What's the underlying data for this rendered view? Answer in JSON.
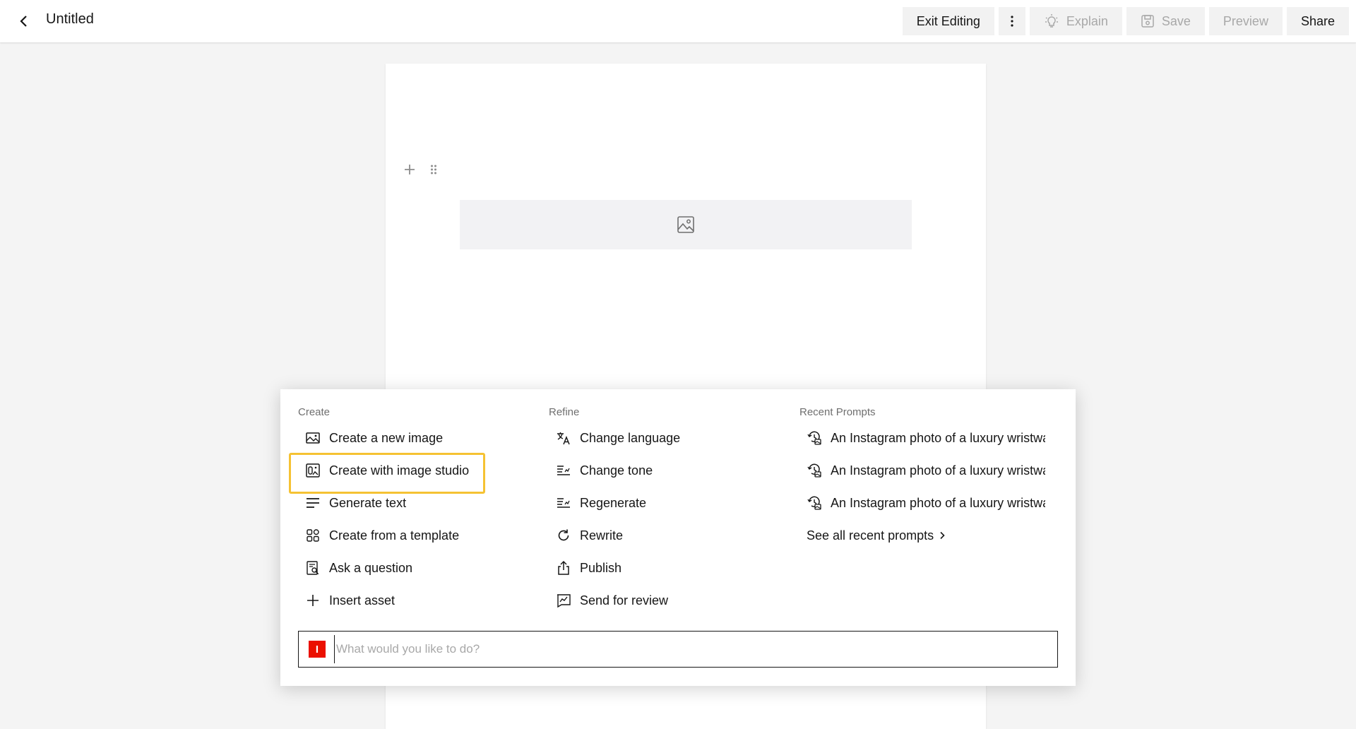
{
  "header": {
    "title": "Untitled",
    "actions": {
      "exit_editing": "Exit Editing",
      "explain": "Explain",
      "save": "Save",
      "preview": "Preview",
      "share": "Share"
    }
  },
  "popup": {
    "create": {
      "heading": "Create",
      "items": [
        {
          "label": "Create a new image",
          "icon": "image-icon"
        },
        {
          "label": "Create with image studio",
          "icon": "image-studio-icon",
          "highlighted": true
        },
        {
          "label": "Generate text",
          "icon": "text-lines-icon"
        },
        {
          "label": "Create from a template",
          "icon": "template-grid-icon"
        },
        {
          "label": "Ask a question",
          "icon": "ask-question-icon"
        },
        {
          "label": "Insert asset",
          "icon": "plus-icon"
        }
      ]
    },
    "refine": {
      "heading": "Refine",
      "items": [
        {
          "label": "Change language",
          "icon": "translate-icon"
        },
        {
          "label": "Change tone",
          "icon": "tone-icon"
        },
        {
          "label": "Regenerate",
          "icon": "regenerate-icon"
        },
        {
          "label": "Rewrite",
          "icon": "refresh-icon"
        },
        {
          "label": "Publish",
          "icon": "publish-icon"
        },
        {
          "label": "Send for review",
          "icon": "review-icon"
        }
      ]
    },
    "recent": {
      "heading": "Recent Prompts",
      "items": [
        {
          "label": "An Instagram photo of a luxury wristwa",
          "icon": "history-prompt-icon"
        },
        {
          "label": "An Instagram photo of a luxury wristwa",
          "icon": "history-prompt-icon"
        },
        {
          "label": "An Instagram photo of a luxury wristwa",
          "icon": "history-prompt-icon"
        }
      ],
      "see_all": "See all recent prompts"
    },
    "prompt": {
      "placeholder": "What would you like to do?",
      "value": ""
    }
  },
  "colors": {
    "highlight": "#f5c233",
    "brand": "#eb1000",
    "canvas": "#f4f4f4"
  }
}
